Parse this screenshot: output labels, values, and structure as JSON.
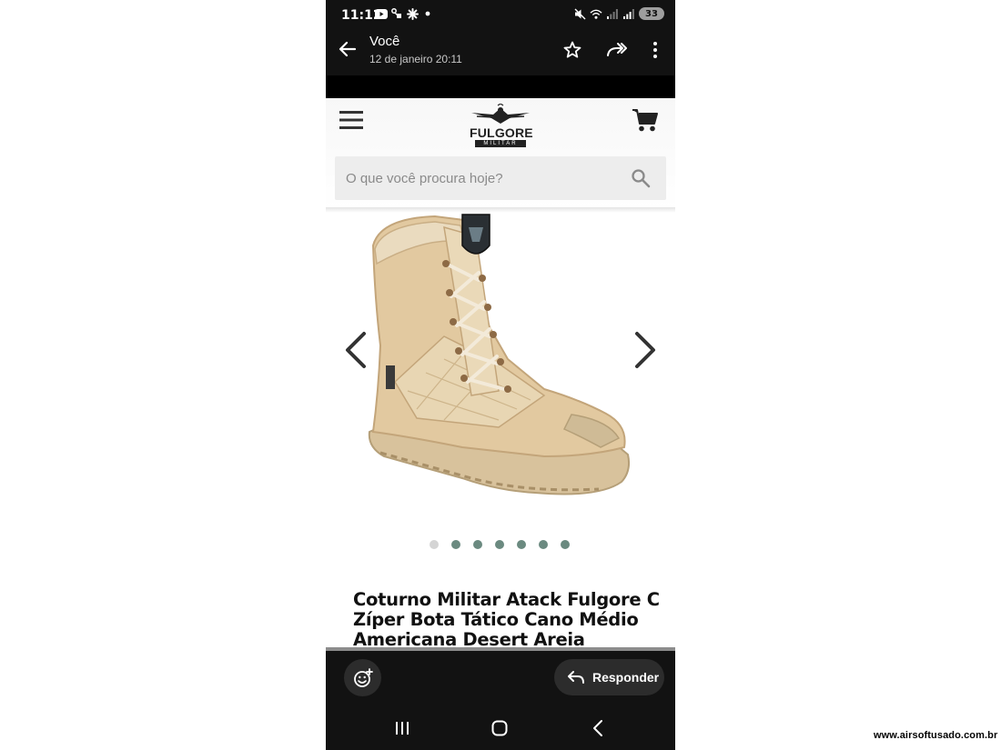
{
  "status_bar": {
    "time": "11:12",
    "battery": "33",
    "left_icons": [
      "youtube-icon",
      "link-icon",
      "flower-icon",
      "dot-icon"
    ],
    "right_icons": [
      "mute-icon",
      "wifi-icon",
      "signal-icon",
      "signal-icon"
    ]
  },
  "app_bar": {
    "sender": "Você",
    "date": "12 de janeiro 20:11"
  },
  "site": {
    "logo_name": "FULGORE",
    "logo_sub": "MILITAR",
    "search_placeholder": "O que você procura hoje?",
    "product_title": "Coturno Militar Atack Fulgore C Zíper Bota Tático Cano Médio Americana Desert Areia",
    "boot_color": "#e2c9a0",
    "gallery_dots_total": 7,
    "gallery_dot_active_index": 0
  },
  "bottom_bar": {
    "reply_label": "Responder"
  },
  "watermark": "www.airsoftusado.com.br"
}
